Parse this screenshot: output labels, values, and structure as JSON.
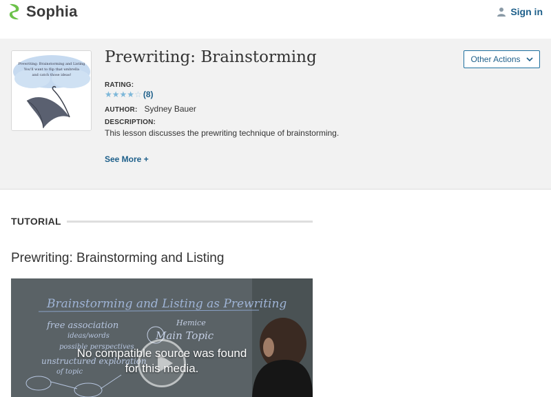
{
  "header": {
    "brand": "Sophia",
    "signin_label": "Sign in"
  },
  "lesson": {
    "title": "Prewriting: Brainstorming",
    "rating_label": "RATING:",
    "rating_stars": 4,
    "rating_max": 5,
    "rating_count": "(8)",
    "author_label": "AUTHOR:",
    "author_name": "Sydney Bauer",
    "description_label": "DESCRIPTION:",
    "description": "This lesson discusses the prewriting technique of brainstorming.",
    "see_more": "See More +",
    "other_actions": "Other Actions",
    "thumbnail": {
      "line1": "Prewriting: Brainstorming and Listing",
      "line2": "You'll want to flip that umbrella",
      "line3": "and catch those ideas!"
    }
  },
  "tutorial": {
    "section_label": "TUTORIAL",
    "title": "Prewriting: Brainstorming and Listing",
    "video_message_line1": "No compatible source was found",
    "video_message_line2": "for this media.",
    "whiteboard": {
      "heading": "Brainstorming and Listing as Prewriting",
      "line1": "free association",
      "line2": "ideas/words",
      "line3": "possible perspectives",
      "line4": "unstructured exploration",
      "line5": "of topic",
      "line6": "Hemice",
      "line7": "Main Topic"
    }
  },
  "colors": {
    "brand_green": "#6cc24a",
    "link_blue": "#1d5f8a",
    "band_bg": "#f2f2f2",
    "star_blue": "#7db7d9"
  }
}
